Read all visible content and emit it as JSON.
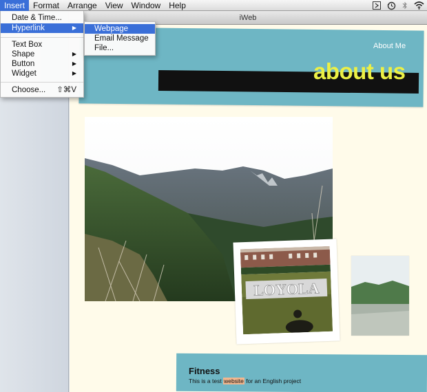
{
  "menubar": {
    "items": [
      "Insert",
      "Format",
      "Arrange",
      "View",
      "Window",
      "Help"
    ],
    "active": "Insert",
    "status_icons": [
      "script-menu-icon",
      "time-machine-icon",
      "bluetooth-icon",
      "wifi-icon"
    ]
  },
  "window": {
    "title": "iWeb"
  },
  "insert_menu": {
    "items": [
      {
        "label": "Date & Time..."
      },
      {
        "label": "Hyperlink",
        "submenu": true
      },
      {
        "label": "Text Box"
      },
      {
        "label": "Shape",
        "submenu": true
      },
      {
        "label": "Button",
        "submenu": true
      },
      {
        "label": "Widget",
        "submenu": true
      },
      {
        "label": "Choose...",
        "shortcut": "⇧⌘V"
      }
    ],
    "highlighted": "Hyperlink"
  },
  "hyperlink_submenu": {
    "items": [
      {
        "label": "Webpage"
      },
      {
        "label": "Email Message"
      },
      {
        "label": "File..."
      }
    ],
    "highlighted": "Webpage"
  },
  "page": {
    "nav_link": "About Me",
    "title": "about us",
    "title_color": "#ecf045",
    "accent_color": "#6eb6c4",
    "background_color": "#fffbea",
    "photos": [
      {
        "subject": "mountain-landscape"
      },
      {
        "subject": "loyola-sign",
        "text": "LOYOLA"
      },
      {
        "subject": "river-landscape"
      }
    ],
    "fitness": {
      "heading": "Fitness",
      "body_before": "This is a test ",
      "body_link": "website",
      "body_after": " for an English project"
    }
  }
}
